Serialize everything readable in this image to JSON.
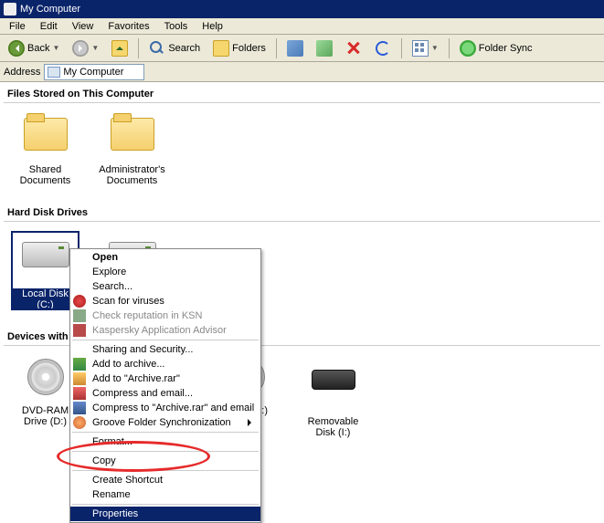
{
  "title": "My Computer",
  "menubar": [
    "File",
    "Edit",
    "View",
    "Favorites",
    "Tools",
    "Help"
  ],
  "toolbar": {
    "back": "Back",
    "search": "Search",
    "folders": "Folders",
    "foldersync": "Folder Sync"
  },
  "addrbar": {
    "label": "Address",
    "value": "My Computer"
  },
  "groups": {
    "files_stored": "Files Stored on This Computer",
    "hard_drives": "Hard Disk Drives",
    "removable": "Devices with Removable Storage"
  },
  "items": {
    "shared_docs": "Shared Documents",
    "admin_docs": "Administrator's Documents",
    "local_disk": "Local Disk (C:)",
    "dvdram": "DVD-RAM Drive (D:)",
    "drive_h": "Drive (H:)",
    "removable_i": "Removable Disk (I:)"
  },
  "context": {
    "open": "Open",
    "explore": "Explore",
    "search": "Search...",
    "scan": "Scan for viruses",
    "ksn": "Check reputation in KSN",
    "kadvisor": "Kaspersky Application Advisor",
    "sharing": "Sharing and Security...",
    "addarchive": "Add to archive...",
    "addrar": "Add to \"Archive.rar\"",
    "compressemail": "Compress and email...",
    "compressrar": "Compress to \"Archive.rar\" and email",
    "groove": "Groove Folder Synchronization",
    "format": "Format...",
    "copy": "Copy",
    "shortcut": "Create Shortcut",
    "rename": "Rename",
    "properties": "Properties"
  }
}
